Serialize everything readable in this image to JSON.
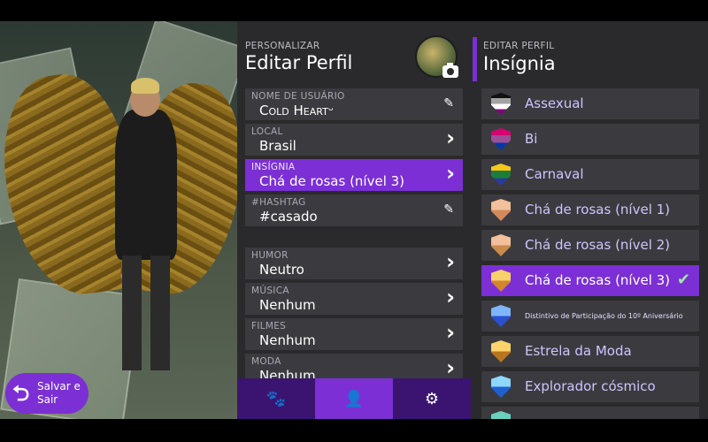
{
  "left": {
    "save_exit_label": "Salvar e Sair"
  },
  "edit_profile": {
    "overline": "PERSONALIZAR",
    "title": "Editar Perfil",
    "fields": [
      {
        "label": "NOME DE USUÁRIO",
        "value": "Cold Heart",
        "value_suffix": "ᵕ",
        "action": "pencil-icon"
      },
      {
        "label": "LOCAL",
        "value": "Brasil",
        "action": "chevron-right-icon"
      },
      {
        "label": "INSÍGNIA",
        "value": "Chá de rosas (nível 3)",
        "action": "chevron-right-icon",
        "selected": true
      },
      {
        "label": "#HASHTAG",
        "value": "#casado",
        "action": "pencil-icon"
      },
      {
        "label": "HUMOR",
        "value": "Neutro",
        "action": "chevron-right-icon"
      },
      {
        "label": "MÚSICA",
        "value": "Nenhum",
        "action": "chevron-right-icon"
      },
      {
        "label": "FILMES",
        "value": "Nenhum",
        "action": "chevron-right-icon"
      },
      {
        "label": "MODA",
        "value": "Nenhum",
        "action": "chevron-right-icon"
      }
    ],
    "tabs": [
      {
        "name": "photo-paw-icon",
        "glyph": "🐾",
        "active": false
      },
      {
        "name": "person-icon",
        "glyph": "👤",
        "active": true
      },
      {
        "name": "sliders-icon",
        "glyph": "⚙",
        "active": false
      }
    ]
  },
  "badge_panel": {
    "overline": "EDITAR PERFIL",
    "title": "Insígnia",
    "badges": [
      {
        "name": "Assexual",
        "colors": [
          "#111111",
          "#a3a3a3",
          "#ffffff",
          "#800080"
        ]
      },
      {
        "name": "Bi",
        "colors": [
          "#d60270",
          "#9b4f96",
          "#0038a8"
        ]
      },
      {
        "name": "Carnaval",
        "colors": [
          "#f7c81b",
          "#1b7f3b",
          "#2b3a9e"
        ]
      },
      {
        "name": "Chá de rosas (nível 1)",
        "colors": [
          "#f2c09b",
          "#d28a5c"
        ]
      },
      {
        "name": "Chá de rosas (nível 2)",
        "colors": [
          "#f2c09b",
          "#c98a4a"
        ]
      },
      {
        "name": "Chá de rosas (nível 3)",
        "colors": [
          "#f7d06b",
          "#d1862d"
        ],
        "selected": true
      },
      {
        "name": "Distintivo de Participação do 10º Aniversário",
        "colors": [
          "#7fb5ff",
          "#2a4fd0"
        ],
        "tiny": true
      },
      {
        "name": "Estrela da Moda",
        "colors": [
          "#ffd36b",
          "#b8751f"
        ]
      },
      {
        "name": "Explorador cósmico",
        "colors": [
          "#8fd7ff",
          "#1f5fd1"
        ]
      },
      {
        "name": "",
        "colors": [
          "#6ad0c0",
          "#2a8a7a"
        ]
      }
    ],
    "check_glyph": "✔"
  }
}
